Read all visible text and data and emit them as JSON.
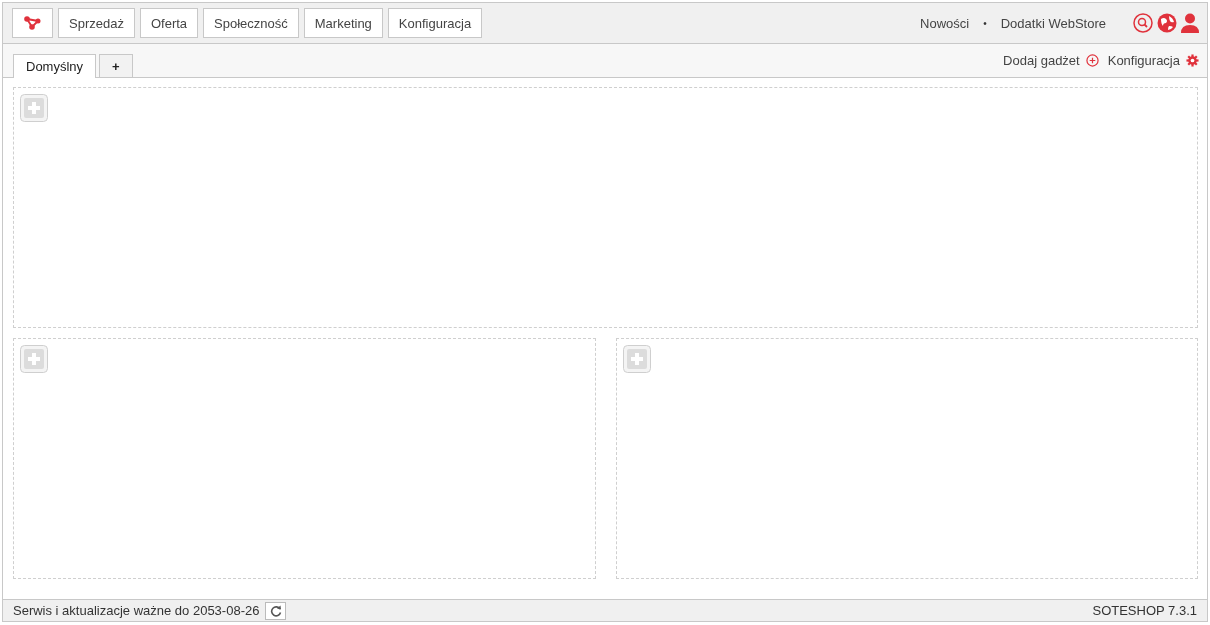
{
  "nav": {
    "items": [
      {
        "label": "Sprzedaż"
      },
      {
        "label": "Oferta"
      },
      {
        "label": "Społeczność"
      },
      {
        "label": "Marketing"
      },
      {
        "label": "Konfiguracja"
      }
    ],
    "links": [
      {
        "label": "Nowości"
      },
      {
        "label": "Dodatki WebStore"
      }
    ],
    "separator": "•"
  },
  "tabs": [
    {
      "label": "Domyślny",
      "selected": true
    },
    {
      "label": "+",
      "selected": false
    }
  ],
  "tab_actions": [
    {
      "label": "Dodaj gadżet",
      "kind": "add"
    },
    {
      "label": "Konfiguracja",
      "kind": "settings"
    }
  ],
  "zones": [
    {
      "kind": "full"
    },
    {
      "kind": "half"
    },
    {
      "kind": "half"
    }
  ],
  "status_bar": {
    "text": "Serwis i aktualizacje ważne do 2053-08-26",
    "version": "SOTESHOP 7.3.1"
  }
}
